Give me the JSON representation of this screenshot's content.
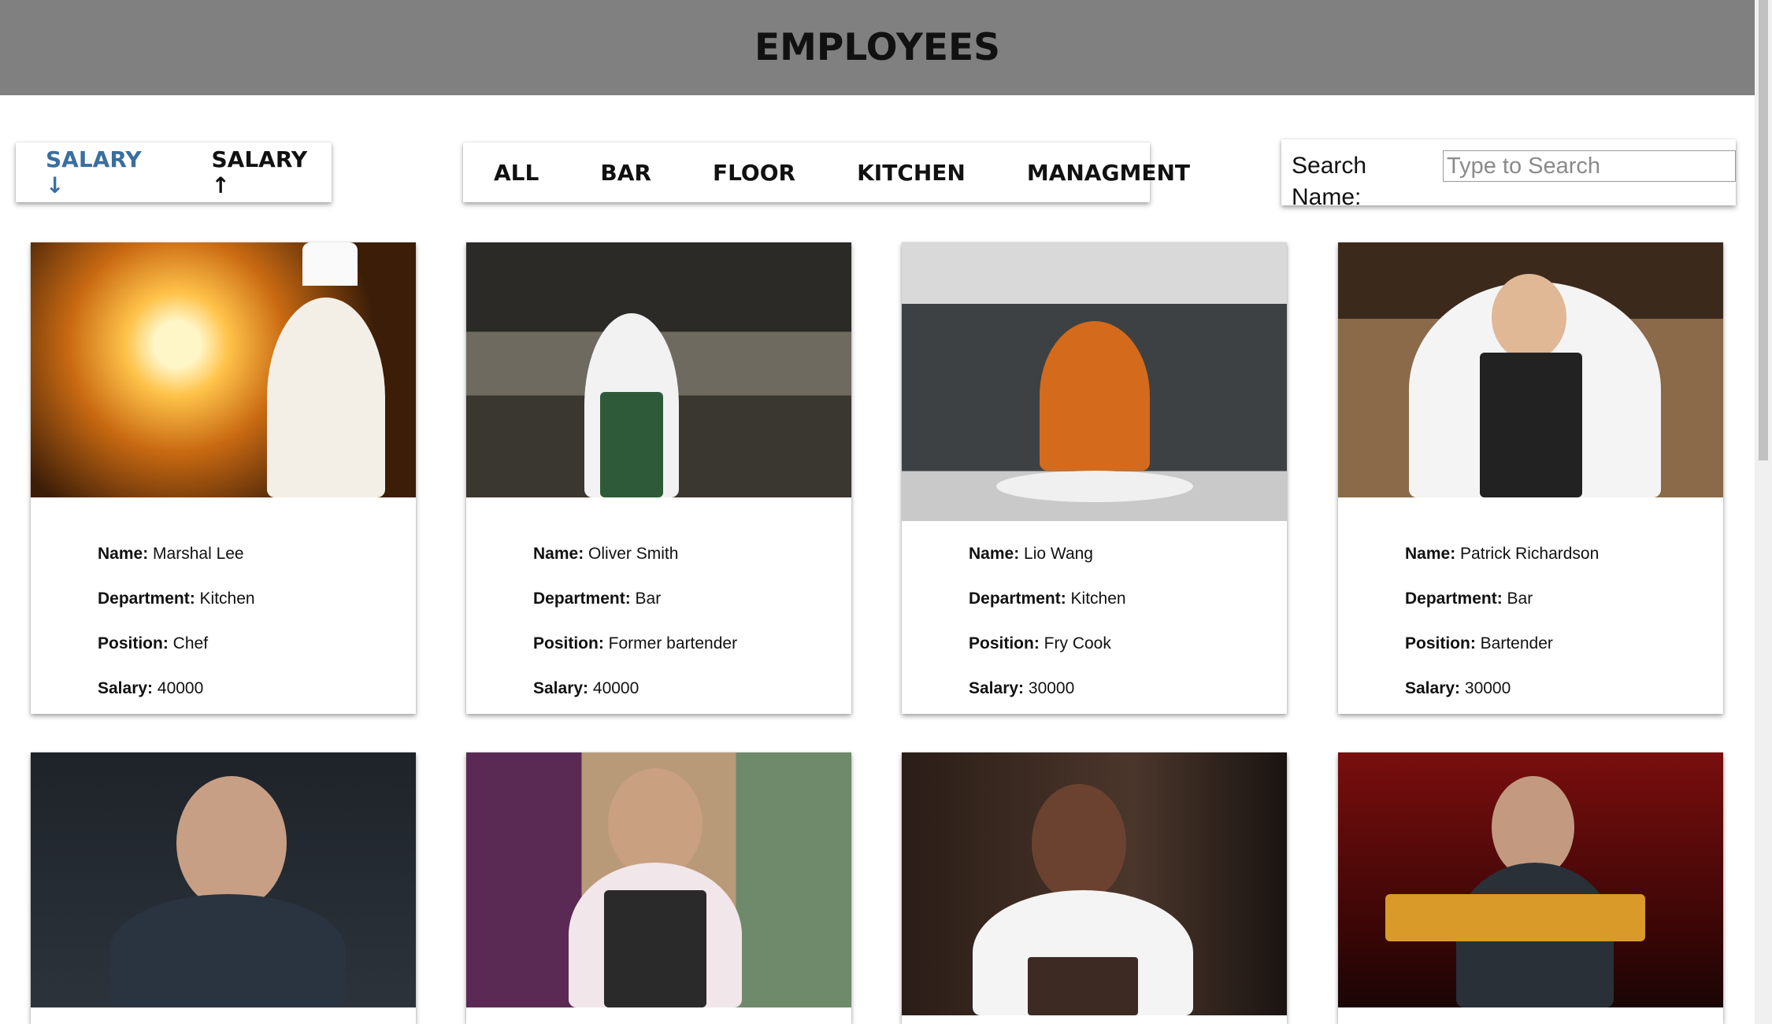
{
  "header": {
    "title": "EMPLOYEES"
  },
  "sort": {
    "desc_label": "SALARY ↓",
    "asc_label": "SALARY ↑"
  },
  "filters": [
    "ALL",
    "BAR",
    "FLOOR",
    "KITCHEN",
    "MANAGMENT"
  ],
  "search": {
    "label": "Search Name:",
    "placeholder": "Type to Search",
    "value": ""
  },
  "labels": {
    "name": "Name:",
    "department": "Department:",
    "position": "Position:",
    "salary": "Salary:"
  },
  "employees": [
    {
      "name": "Marshal Lee",
      "department": "Kitchen",
      "position": "Chef",
      "salary": "40000"
    },
    {
      "name": "Oliver Smith",
      "department": "Bar",
      "position": "Former bartender",
      "salary": "40000"
    },
    {
      "name": "Lio Wang",
      "department": "Kitchen",
      "position": "Fry Cook",
      "salary": "30000"
    },
    {
      "name": "Patrick Richardson",
      "department": "Bar",
      "position": "Bartender",
      "salary": "30000"
    }
  ],
  "colors": {
    "header_bg": "#808080",
    "active_sort": "#3a6e9e"
  }
}
